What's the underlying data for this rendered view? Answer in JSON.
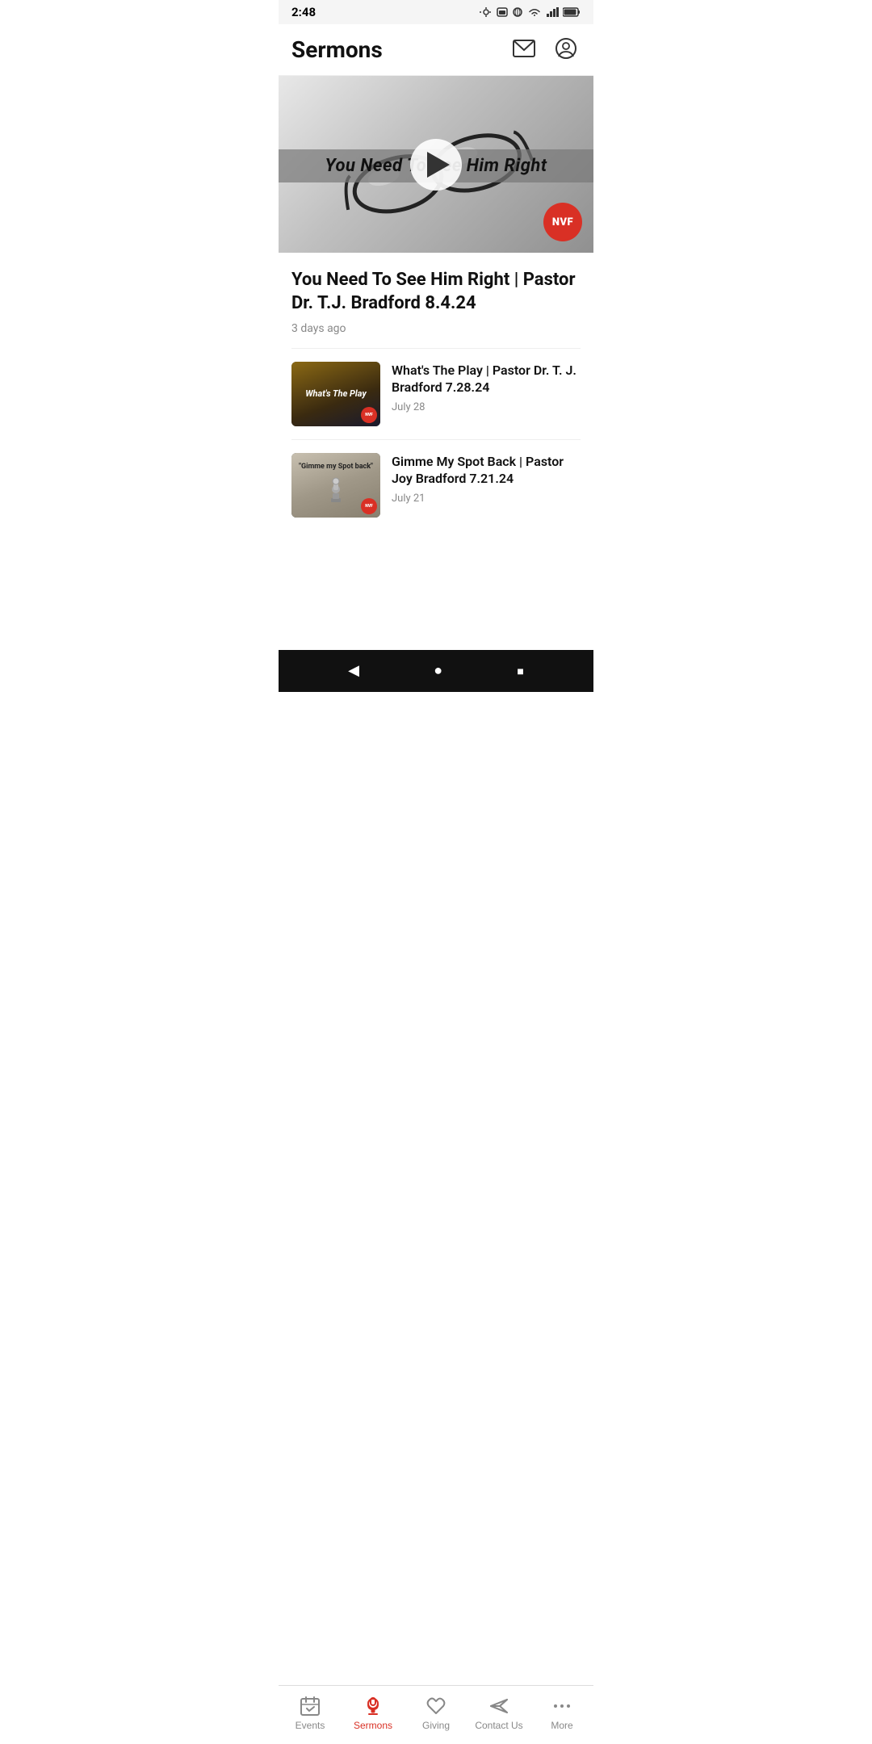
{
  "statusBar": {
    "time": "2:48",
    "icons": [
      "settings",
      "sim",
      "vpn",
      "wifi",
      "signal",
      "battery"
    ]
  },
  "header": {
    "title": "Sermons",
    "mailIcon": "✉",
    "profileIcon": "👤"
  },
  "featuredVideo": {
    "title": "You Need To See Him Right | Pastor Dr. T.J. Bradford 8.4.24",
    "date": "3 days ago",
    "overlayText": "You Need To See Him Right",
    "badgeText": "NVF"
  },
  "sermons": [
    {
      "title": "What's The Play | Pastor Dr. T. J. Bradford 7.28.24",
      "date": "July 28",
      "thumbLabel": "What's The Play",
      "thumbType": "whatsplay",
      "badgeText": "NVF"
    },
    {
      "title": "Gimme My Spot Back | Pastor Joy Bradford 7.21.24",
      "date": "July 21",
      "thumbLabel": "\"Gimme my Spot back\"",
      "thumbType": "gimme",
      "badgeText": "NVF"
    }
  ],
  "bottomNav": {
    "items": [
      {
        "id": "events",
        "label": "Events",
        "icon": "events",
        "active": false
      },
      {
        "id": "sermons",
        "label": "Sermons",
        "icon": "microphone",
        "active": true
      },
      {
        "id": "giving",
        "label": "Giving",
        "icon": "heart",
        "active": false
      },
      {
        "id": "contact",
        "label": "Contact Us",
        "icon": "send",
        "active": false
      },
      {
        "id": "more",
        "label": "More",
        "icon": "dots",
        "active": false
      }
    ]
  },
  "androidNav": {
    "back": "◀",
    "home": "●",
    "recent": "■"
  }
}
